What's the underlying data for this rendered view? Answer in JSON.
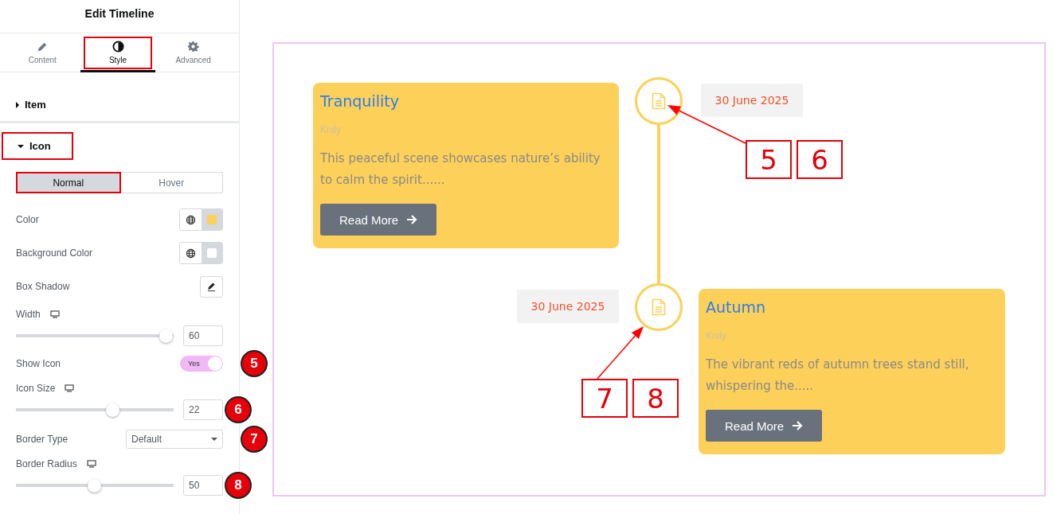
{
  "panel": {
    "title": "Edit Timeline",
    "tabs": [
      {
        "label": "Content",
        "selected": false,
        "highlighted": false
      },
      {
        "label": "Style",
        "selected": true,
        "highlighted": true
      },
      {
        "label": "Advanced",
        "selected": false,
        "highlighted": false
      }
    ],
    "sections": [
      {
        "label": "Item",
        "expanded": false,
        "highlighted": false
      },
      {
        "label": "Icon",
        "expanded": true,
        "highlighted": true
      }
    ],
    "state_tabs": [
      {
        "label": "Normal",
        "selected": true,
        "highlighted": true
      },
      {
        "label": "Hover",
        "selected": false,
        "highlighted": false
      }
    ],
    "controls": [
      {
        "kind": "color",
        "label": "Color",
        "color": "#fcd15a"
      },
      {
        "kind": "color",
        "label": "Background Color",
        "color": "#ffffff"
      },
      {
        "kind": "edit",
        "label": "Box Shadow"
      },
      {
        "kind": "slider",
        "label": "Width",
        "responsive": true,
        "level": 1,
        "value": "60"
      },
      {
        "kind": "switch",
        "label": "Show Icon",
        "on": true,
        "switch_text": "Yes",
        "badge": "5"
      },
      {
        "kind": "slider",
        "label": "Icon Size",
        "responsive": true,
        "level": 0.63,
        "value": "22",
        "badge": "6"
      },
      {
        "kind": "select",
        "label": "Border Type",
        "value": "Default",
        "badge": "7"
      },
      {
        "kind": "slider",
        "label": "Border Radius",
        "responsive": true,
        "level": 0.5,
        "value": "50",
        "badge": "8"
      }
    ]
  },
  "timeline": {
    "items": [
      {
        "title": "Tranquility",
        "author": "Knily",
        "text": "This peaceful scene showcases nature’s ability to calm the spirit......",
        "button": "Read More",
        "date": "30 June 2025"
      },
      {
        "title": "Autumn",
        "author": "Knily",
        "text": "The vibrant reds of autumn trees stand still, whispering the.....",
        "button": "Read More",
        "date": "30 June 2025"
      }
    ]
  },
  "callouts": [
    {
      "labels": [
        "5",
        "6"
      ]
    },
    {
      "labels": [
        "7",
        "8"
      ]
    }
  ]
}
